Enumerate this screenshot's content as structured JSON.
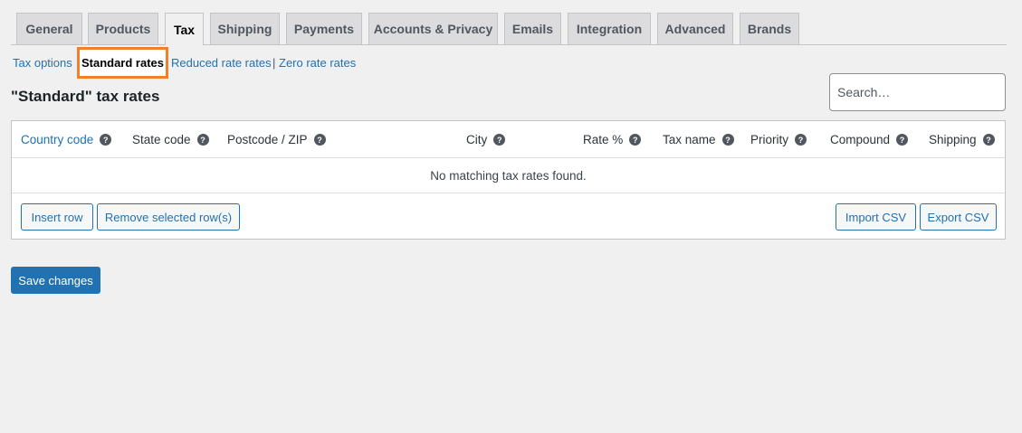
{
  "tabs": [
    {
      "label": "General"
    },
    {
      "label": "Products"
    },
    {
      "label": "Tax",
      "active": true
    },
    {
      "label": "Shipping"
    },
    {
      "label": "Payments"
    },
    {
      "label": "Accounts & Privacy"
    },
    {
      "label": "Emails"
    },
    {
      "label": "Integration"
    },
    {
      "label": "Advanced"
    },
    {
      "label": "Brands"
    }
  ],
  "subnav": {
    "tax_options": "Tax options",
    "standard_rates": "Standard rates",
    "reduced_rate_rates": "Reduced rate rates",
    "zero_rate_rates": "Zero rate rates",
    "separator": "|"
  },
  "heading": "\"Standard\" tax rates",
  "search": {
    "placeholder": "Search…"
  },
  "table": {
    "columns": [
      {
        "label": "Country code"
      },
      {
        "label": "State code"
      },
      {
        "label": "Postcode / ZIP"
      },
      {
        "label": "City"
      },
      {
        "label": "Rate %"
      },
      {
        "label": "Tax name"
      },
      {
        "label": "Priority"
      },
      {
        "label": "Compound"
      },
      {
        "label": "Shipping"
      }
    ],
    "help_glyph": "?",
    "empty_message": "No matching tax rates found.",
    "insert_row": "Insert row",
    "remove_rows": "Remove selected row(s)",
    "import_csv": "Import CSV",
    "export_csv": "Export CSV"
  },
  "save_changes": "Save changes",
  "colors": {
    "accent": "#2271b1",
    "highlight": "#f27f2b"
  }
}
